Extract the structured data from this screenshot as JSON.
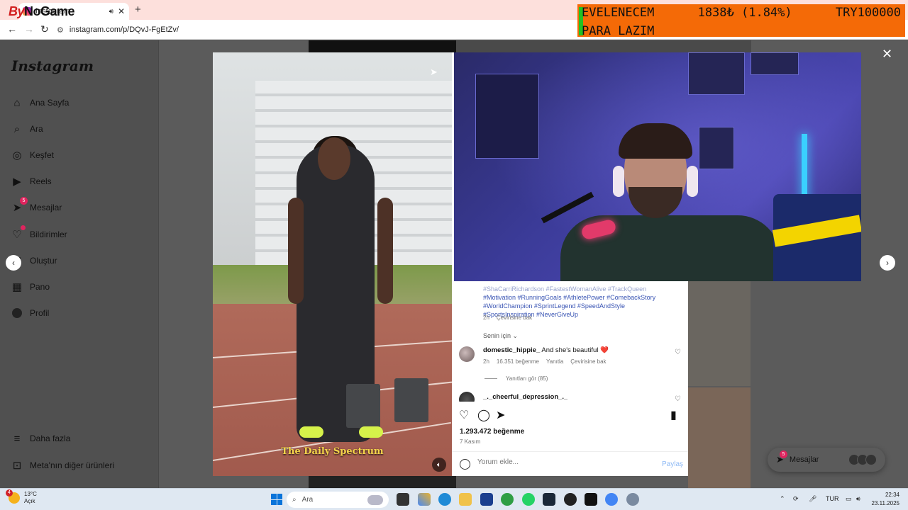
{
  "browser": {
    "tab_title": "Instagram",
    "overlay_brand_1": "By",
    "overlay_brand_2": "NoGame",
    "url": "instagram.com/p/DQvJ-FgEtZv/"
  },
  "donation": {
    "name": "EVELENECEM",
    "amount": "1838₺ (1.84%)",
    "goal": "TRY100000",
    "message": "PARA LAZIM"
  },
  "sidebar": {
    "logo": "Instagram",
    "items": [
      {
        "label": "Ana Sayfa",
        "icon": "home-icon"
      },
      {
        "label": "Ara",
        "icon": "search-icon"
      },
      {
        "label": "Keşfet",
        "icon": "compass-icon"
      },
      {
        "label": "Reels",
        "icon": "reels-icon"
      },
      {
        "label": "Mesajlar",
        "icon": "messenger-icon",
        "badge": "5"
      },
      {
        "label": "Bildirimler",
        "icon": "heart-icon"
      },
      {
        "label": "Oluştur",
        "icon": "plus-icon"
      },
      {
        "label": "Pano",
        "icon": "dashboard-icon"
      },
      {
        "label": "Profil",
        "icon": "profile-avatar"
      }
    ],
    "more": "Daha fazla",
    "meta": "Meta'nın diğer ürünleri"
  },
  "post": {
    "video_caption": "The Daily Spectrum",
    "hashtags": [
      "#ShaCarriRichardson #FastestWomanAlive #TrackQueen",
      "#Motivation #RunningGoals #AthletePower #ComebackStory",
      "#WorldChampion #SprintLegend #SpeedAndStyle",
      "#SportsInspiration #NeverGiveUp"
    ],
    "caption_time": "2h",
    "caption_translate": "Çevirisine bak",
    "for_you": "Senin için",
    "comments": [
      {
        "user": "domestic_hippie_",
        "text": "And she's beautiful ❤️",
        "time": "2h",
        "likes": "16.351 beğenme",
        "reply": "Yanıtla",
        "translate": "Çevirisine bak",
        "view_replies": "Yanıtları gör (85)"
      },
      {
        "user": "_._cheerful_depression_._"
      }
    ],
    "likes": "1.293.472 beğenme",
    "date": "7 Kasım",
    "comment_placeholder": "Yorum ekle...",
    "post_button": "Paylaş"
  },
  "floating_messages": {
    "label": "Mesajlar",
    "badge": "5"
  },
  "taskbar": {
    "weather_temp": "13°C",
    "weather_desc": "Açık",
    "weather_badge": "4",
    "search_placeholder": "Ara",
    "lang": "TUR",
    "time": "22:34",
    "date": "23.11.2025"
  }
}
